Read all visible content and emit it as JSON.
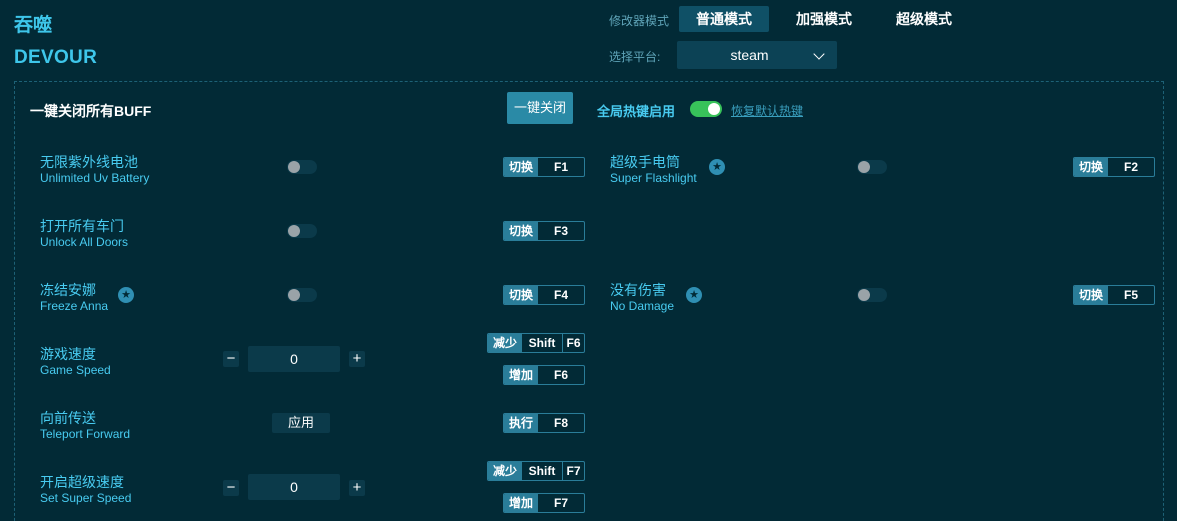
{
  "header": {
    "title_zh": "吞噬",
    "title_en": "DEVOUR"
  },
  "mode": {
    "label": "修改器模式",
    "options": [
      "普通模式",
      "加强模式",
      "超级模式"
    ],
    "active": "普通模式"
  },
  "platform": {
    "label": "选择平台:",
    "value": "steam"
  },
  "global": {
    "title": "一键关闭所有BUFF",
    "oneclick_label": "一键关闭",
    "hotkey_label": "全局热键启用",
    "hotkey_enabled": true,
    "restore_label": "恢复默认热键"
  },
  "features": [
    {
      "zh": "无限紫外线电池",
      "en": "Unlimited Uv Battery",
      "action": "切换",
      "key": "F1"
    },
    {
      "zh": "超级手电筒",
      "en": "Super Flashlight",
      "action": "切换",
      "key": "F2",
      "starred": true
    },
    {
      "zh": "打开所有车门",
      "en": "Unlock All Doors",
      "action": "切换",
      "key": "F3"
    },
    {
      "zh": "冻结安娜",
      "en": "Freeze Anna",
      "action": "切换",
      "key": "F4",
      "starred": true
    },
    {
      "zh": "没有伤害",
      "en": "No Damage",
      "action": "切换",
      "key": "F5",
      "starred": true
    },
    {
      "zh": "游戏速度",
      "en": "Game Speed",
      "value": "0",
      "dec_action": "减少",
      "dec_mod": "Shift",
      "dec_key": "F6",
      "inc_action": "增加",
      "inc_key": "F6"
    },
    {
      "zh": "向前传送",
      "en": "Teleport Forward",
      "apply_label": "应用",
      "action": "执行",
      "key": "F8"
    },
    {
      "zh": "开启超级速度",
      "en": "Set Super Speed",
      "value": "0",
      "dec_action": "减少",
      "dec_mod": "Shift",
      "dec_key": "F7",
      "inc_action": "增加",
      "inc_key": "F7"
    }
  ],
  "icons": {
    "star": "star-icon",
    "minus": "minus-icon",
    "plus": "plus-icon",
    "chevron": "chevron-down-icon"
  },
  "colors": {
    "background": "#022a36",
    "accent": "#48cbf0",
    "toggle_on": "#38c25a",
    "key_badge": "#2a7d99"
  }
}
